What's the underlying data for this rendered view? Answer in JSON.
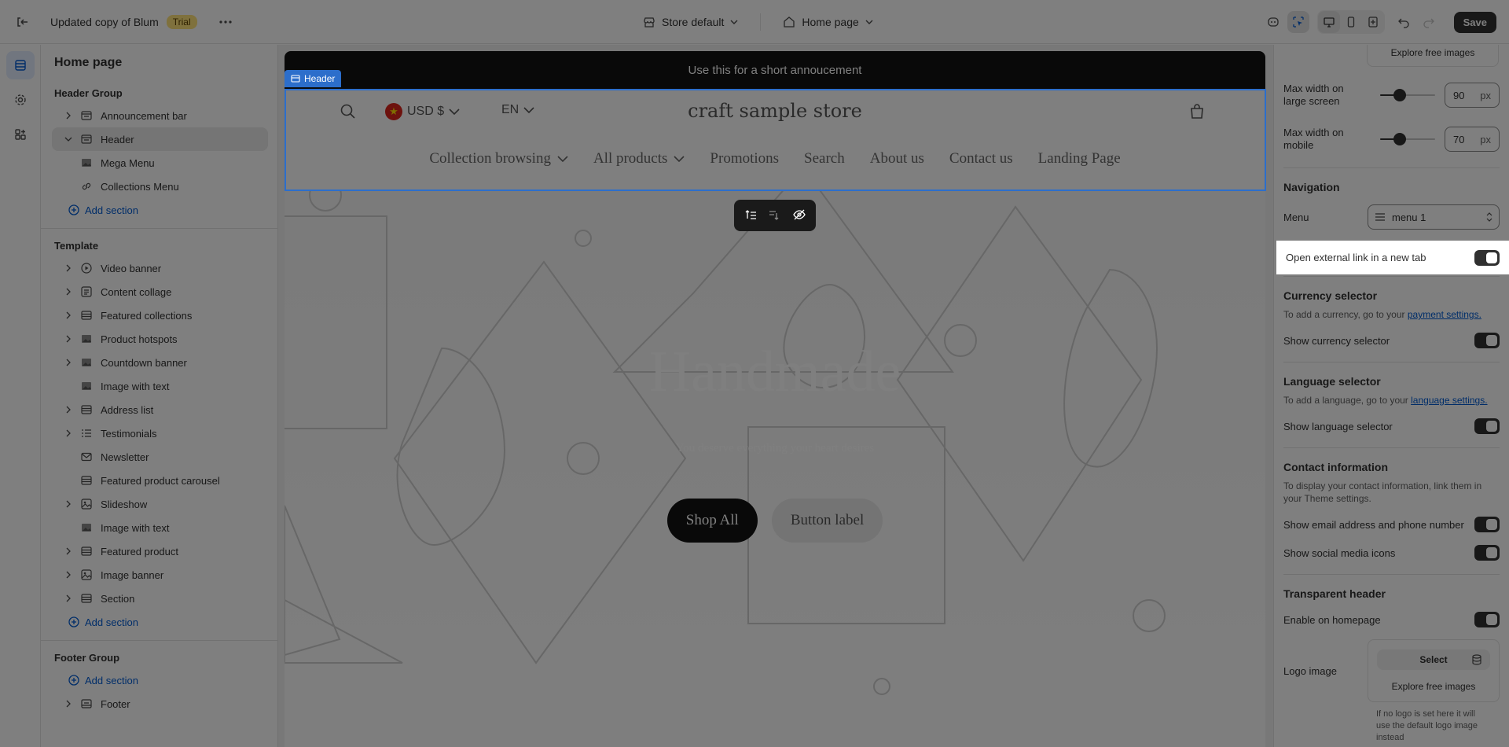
{
  "topbar": {
    "title": "Updated copy of Blum",
    "trial_badge": "Trial",
    "theme_select": "Store default",
    "page_select": "Home page",
    "save_label": "Save"
  },
  "sidebar": {
    "title": "Home page",
    "header_group": {
      "heading": "Header Group",
      "items": [
        {
          "label": "Announcement bar"
        },
        {
          "label": "Header"
        },
        {
          "label": "Mega Menu"
        },
        {
          "label": "Collections Menu"
        }
      ],
      "add_section": "Add section"
    },
    "template": {
      "heading": "Template",
      "items": [
        {
          "label": "Video banner"
        },
        {
          "label": "Content collage"
        },
        {
          "label": "Featured collections"
        },
        {
          "label": "Product hotspots"
        },
        {
          "label": "Countdown banner"
        },
        {
          "label": "Image with text"
        },
        {
          "label": "Address list"
        },
        {
          "label": "Testimonials"
        },
        {
          "label": "Newsletter"
        },
        {
          "label": "Featured product carousel"
        },
        {
          "label": "Slideshow"
        },
        {
          "label": "Image with text"
        },
        {
          "label": "Featured product"
        },
        {
          "label": "Image banner"
        },
        {
          "label": "Section"
        }
      ],
      "add_section": "Add section"
    },
    "footer_group": {
      "heading": "Footer Group",
      "add_section": "Add section",
      "items": [
        {
          "label": "Footer"
        }
      ]
    }
  },
  "preview": {
    "announcement": "Use this for a short annoucement",
    "selection_tag": "Header",
    "currency": "USD $",
    "language": "EN",
    "store_name": "craft sample store",
    "nav": [
      "Collection browsing",
      "All products",
      "Promotions",
      "Search",
      "About us",
      "Contact us",
      "Landing Page"
    ],
    "hero_title": "Handmade",
    "hero_subtitle": "You deserve everything your heart desires",
    "primary_button": "Shop All",
    "secondary_button": "Button label"
  },
  "settings": {
    "explore_images": "Explore free images",
    "max_width_large_label": "Max width on large screen",
    "max_width_large_value": "90",
    "max_width_large_fraction": 0.36,
    "max_width_mobile_label": "Max width on mobile",
    "max_width_mobile_value": "70",
    "max_width_mobile_fraction": 0.36,
    "unit": "px",
    "navigation_heading": "Navigation",
    "menu_label": "Menu",
    "menu_value": "menu 1",
    "open_external_label": "Open external link in a new tab",
    "currency_heading": "Currency selector",
    "currency_help": "To add a currency, go to your",
    "currency_link": "payment settings.",
    "show_currency_label": "Show currency selector",
    "language_heading": "Language selector",
    "language_help": "To add a language, go to your",
    "language_link": "language settings.",
    "show_language_label": "Show language selector",
    "contact_heading": "Contact information",
    "contact_help": "To display your contact information, link them in your Theme settings.",
    "show_email_label": "Show email address and phone number",
    "show_social_label": "Show social media icons",
    "transparent_heading": "Transparent header",
    "enable_homepage_label": "Enable on homepage",
    "logo_image_label": "Logo image",
    "select_label": "Select",
    "explore_images_2": "Explore free images",
    "logo_help": "If no logo is set here it will use the default logo image instead"
  }
}
